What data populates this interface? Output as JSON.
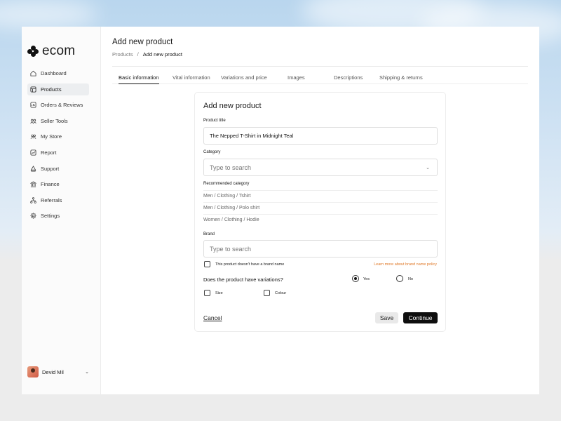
{
  "brand": {
    "logo_text": "ecom"
  },
  "sidebar": {
    "items": [
      {
        "label": "Dashboard",
        "icon": "home-icon"
      },
      {
        "label": "Products",
        "icon": "box-icon",
        "active": true
      },
      {
        "label": "Orders & Reviews",
        "icon": "orders-icon"
      },
      {
        "label": "Seller Tools",
        "icon": "tools-icon"
      },
      {
        "label": "My Store",
        "icon": "store-icon"
      },
      {
        "label": "Report",
        "icon": "chart-icon"
      },
      {
        "label": "Support",
        "icon": "support-icon"
      },
      {
        "label": "Finance",
        "icon": "bank-icon"
      },
      {
        "label": "Referrals",
        "icon": "network-icon"
      },
      {
        "label": "Settings",
        "icon": "gear-icon"
      }
    ],
    "user": {
      "name": "Devid Mil"
    }
  },
  "header": {
    "title": "Add new product",
    "breadcrumb": {
      "root": "Products",
      "sep": "/",
      "current": "Add new product"
    }
  },
  "tabs": [
    {
      "label": "Basic information",
      "active": true
    },
    {
      "label": "Vital information"
    },
    {
      "label": "Variations and price"
    },
    {
      "label": "Images"
    },
    {
      "label": "Descriptions"
    },
    {
      "label": "Shipping & returns"
    }
  ],
  "form": {
    "title": "Add new product",
    "product_title_label": "Product title",
    "product_title_value": "The Nepped T-Shirt in Midnight Teal",
    "category_label": "Category",
    "category_placeholder": "Type to search",
    "recommended_label": "Recommended category",
    "recommended": [
      "Men / Clothing / Tshirt",
      "Men / Clothing / Polo shirt",
      "Women / Clothing / Hodie"
    ],
    "brand_label": "Brand",
    "brand_placeholder": "Type to search",
    "no_brand_label": "This product doesn't have a brand name",
    "brand_policy_link": "Learn more about brand name policy",
    "variations_question": "Does the product have variations?",
    "yes_label": "Yes",
    "no_label": "No",
    "size_label": "Size",
    "colour_label": "Colour",
    "cancel_label": "Cancel",
    "save_label": "Save",
    "continue_label": "Continue"
  },
  "colors": {
    "accent": "#0e0e0e",
    "link": "#e07a2a",
    "active_nav": "#eceef0"
  }
}
